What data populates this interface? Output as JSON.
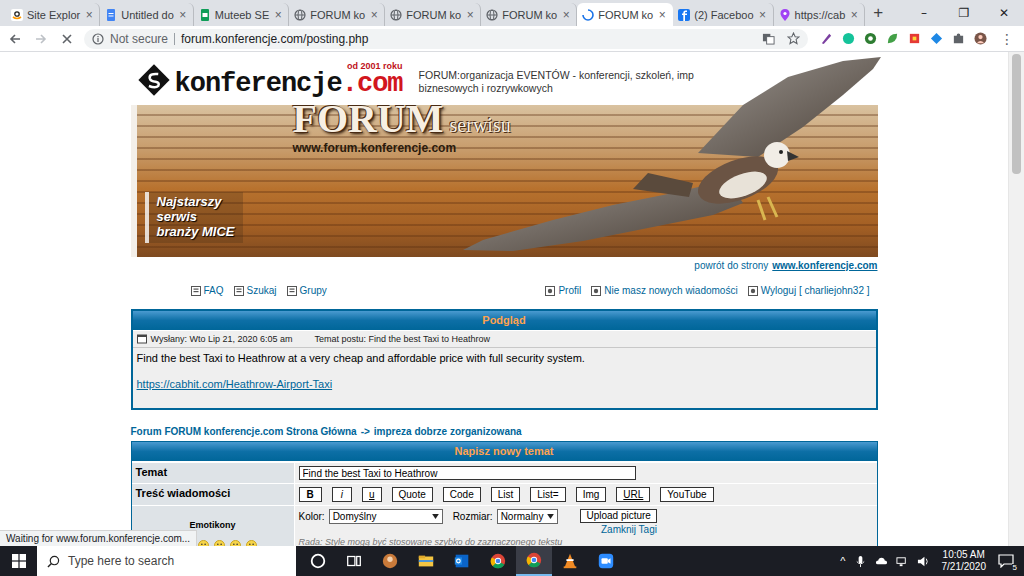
{
  "tabs": [
    {
      "label": "Site Explor",
      "kind": "amazon",
      "selected": false
    },
    {
      "label": "Untitled do",
      "kind": "docs",
      "selected": false
    },
    {
      "label": "Muteeb SE",
      "kind": "sheets",
      "selected": false
    },
    {
      "label": "FORUM ko",
      "kind": "globe",
      "selected": false
    },
    {
      "label": "FORUM ko",
      "kind": "globe",
      "selected": false
    },
    {
      "label": "FORUM ko",
      "kind": "globe",
      "selected": false
    },
    {
      "label": "FORUM ko",
      "kind": "loading",
      "selected": true
    },
    {
      "label": "(2) Faceboo",
      "kind": "facebook",
      "selected": false
    },
    {
      "label": "https://cab",
      "kind": "maps",
      "selected": false
    }
  ],
  "tab_close": "×",
  "new_tab": "+",
  "window_controls": [
    "–",
    "❐",
    "✕"
  ],
  "toolbar": {
    "security": "Not secure",
    "url": "forum.konferencje.com/posting.php",
    "menu": "⋮"
  },
  "status": "Waiting for www.forum.konferencje.com...",
  "site": {
    "logo": {
      "name": "konferencje",
      "tld": ".com"
    },
    "since": "od 2001 roku",
    "tagline": [
      "FORUM:organizacja EVENTÓW - konferencji, szkoleń, imp",
      "biznesowych i rozrywkowych"
    ],
    "banner_title": "FORUM",
    "banner_subtitle": "serwisu",
    "banner_url": "www.forum.konferencje.com",
    "banner_slogan": [
      "Najstarszy",
      "serwis",
      "branży MICE"
    ],
    "back_link": {
      "prefix": "powrót do strony",
      "site": "www.konferencje.com"
    }
  },
  "nav": {
    "left": [
      {
        "label": "FAQ"
      },
      {
        "label": "Szukaj"
      },
      {
        "label": "Grupy"
      }
    ],
    "right": [
      {
        "label": "Profil"
      },
      {
        "label": "Nie masz nowych wiadomości"
      },
      {
        "label": "Wyloguj [ charliejohn32 ]"
      }
    ]
  },
  "preview": {
    "title": "Podgląd",
    "posted": "Wysłany: Wto Lip 21, 2020 6:05 am",
    "subject": "Temat postu: Find the best Taxi to Heathrow",
    "body": "Find the best Taxi to Heathrow at a very cheap and affordable price with full security system.",
    "link": "https://cabhit.com/Heathrow-Airport-Taxi"
  },
  "breadcrumb": {
    "home": "Forum FORUM konferencje.com Strona Główna",
    "separator": "->",
    "forum": "impreza dobrze zorganizowana"
  },
  "form": {
    "title": "Napisz nowy temat",
    "subject_label": "Temat",
    "subject_value": "Find the best Taxi to Heathrow",
    "message_label": "Treść wiadomości",
    "emoticons_label": "Emotikony",
    "tag_buttons": [
      {
        "label": "B",
        "kind": "bold"
      },
      {
        "label": "i",
        "kind": "italic"
      },
      {
        "label": "u",
        "kind": "underline"
      },
      {
        "label": "Quote",
        "kind": "plain"
      },
      {
        "label": "Code",
        "kind": "plain"
      },
      {
        "label": "List",
        "kind": "plain"
      },
      {
        "label": "List=",
        "kind": "plain"
      },
      {
        "label": "Img",
        "kind": "plain"
      },
      {
        "label": "URL",
        "kind": "underline"
      },
      {
        "label": "YouTube",
        "kind": "plain"
      }
    ],
    "color_label": "Kolor:",
    "color_value": "Domyślny",
    "size_label": "Rozmiar:",
    "size_value": "Normalny",
    "upload": "Upload picture",
    "close_tags": "Zamknij Tagi",
    "hint": "Rada: Style mogą być stosowane szybko do zaznaczonego tekstu"
  },
  "taskbar": {
    "search_placeholder": "Type here to search",
    "tray_arrow": "^",
    "time": "10:05 AM",
    "date": "7/21/2020",
    "notifications": "5"
  }
}
